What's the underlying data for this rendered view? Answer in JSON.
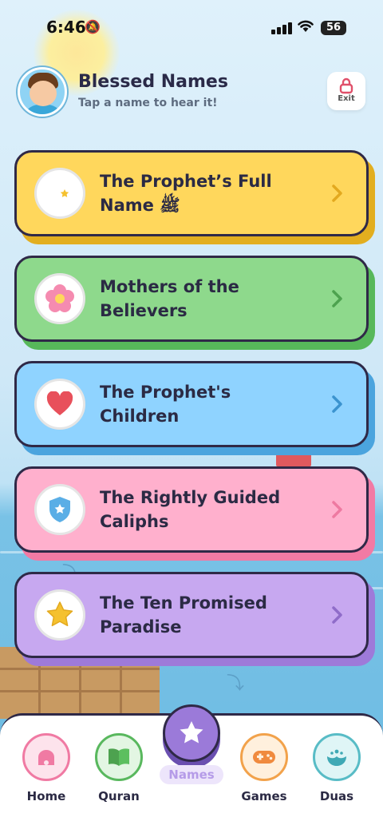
{
  "status_bar": {
    "time": "6:46",
    "battery": "56"
  },
  "header": {
    "title": "Blessed Names",
    "subtitle": "Tap a name to hear it!",
    "exit_label": "Exit"
  },
  "cards": [
    {
      "title": "The Prophet’s Full Name ﷺ",
      "color": "#ffd75c",
      "shadow": "#e2ae1f",
      "chevron": "#e3a91f",
      "icon": "crescent-star-icon"
    },
    {
      "title": "Mothers of the Believers",
      "color": "#8ed98c",
      "shadow": "#57b85a",
      "chevron": "#4da24f",
      "icon": "flower-icon"
    },
    {
      "title": "The Prophet's Children",
      "color": "#8fd3ff",
      "shadow": "#4ba4de",
      "chevron": "#3b93cf",
      "icon": "heart-icon"
    },
    {
      "title": "The Rightly Guided Caliphs",
      "color": "#ffb0cd",
      "shadow": "#f27aa4",
      "chevron": "#ee7aa1",
      "icon": "shield-star-icon"
    },
    {
      "title": "The Ten Promised Paradise",
      "color": "#c7a8f0",
      "shadow": "#9e7ad9",
      "chevron": "#8f6cc9",
      "icon": "star-icon"
    }
  ],
  "nav": {
    "home": "Home",
    "quran": "Quran",
    "names": "Names",
    "games": "Games",
    "duas": "Duas"
  }
}
